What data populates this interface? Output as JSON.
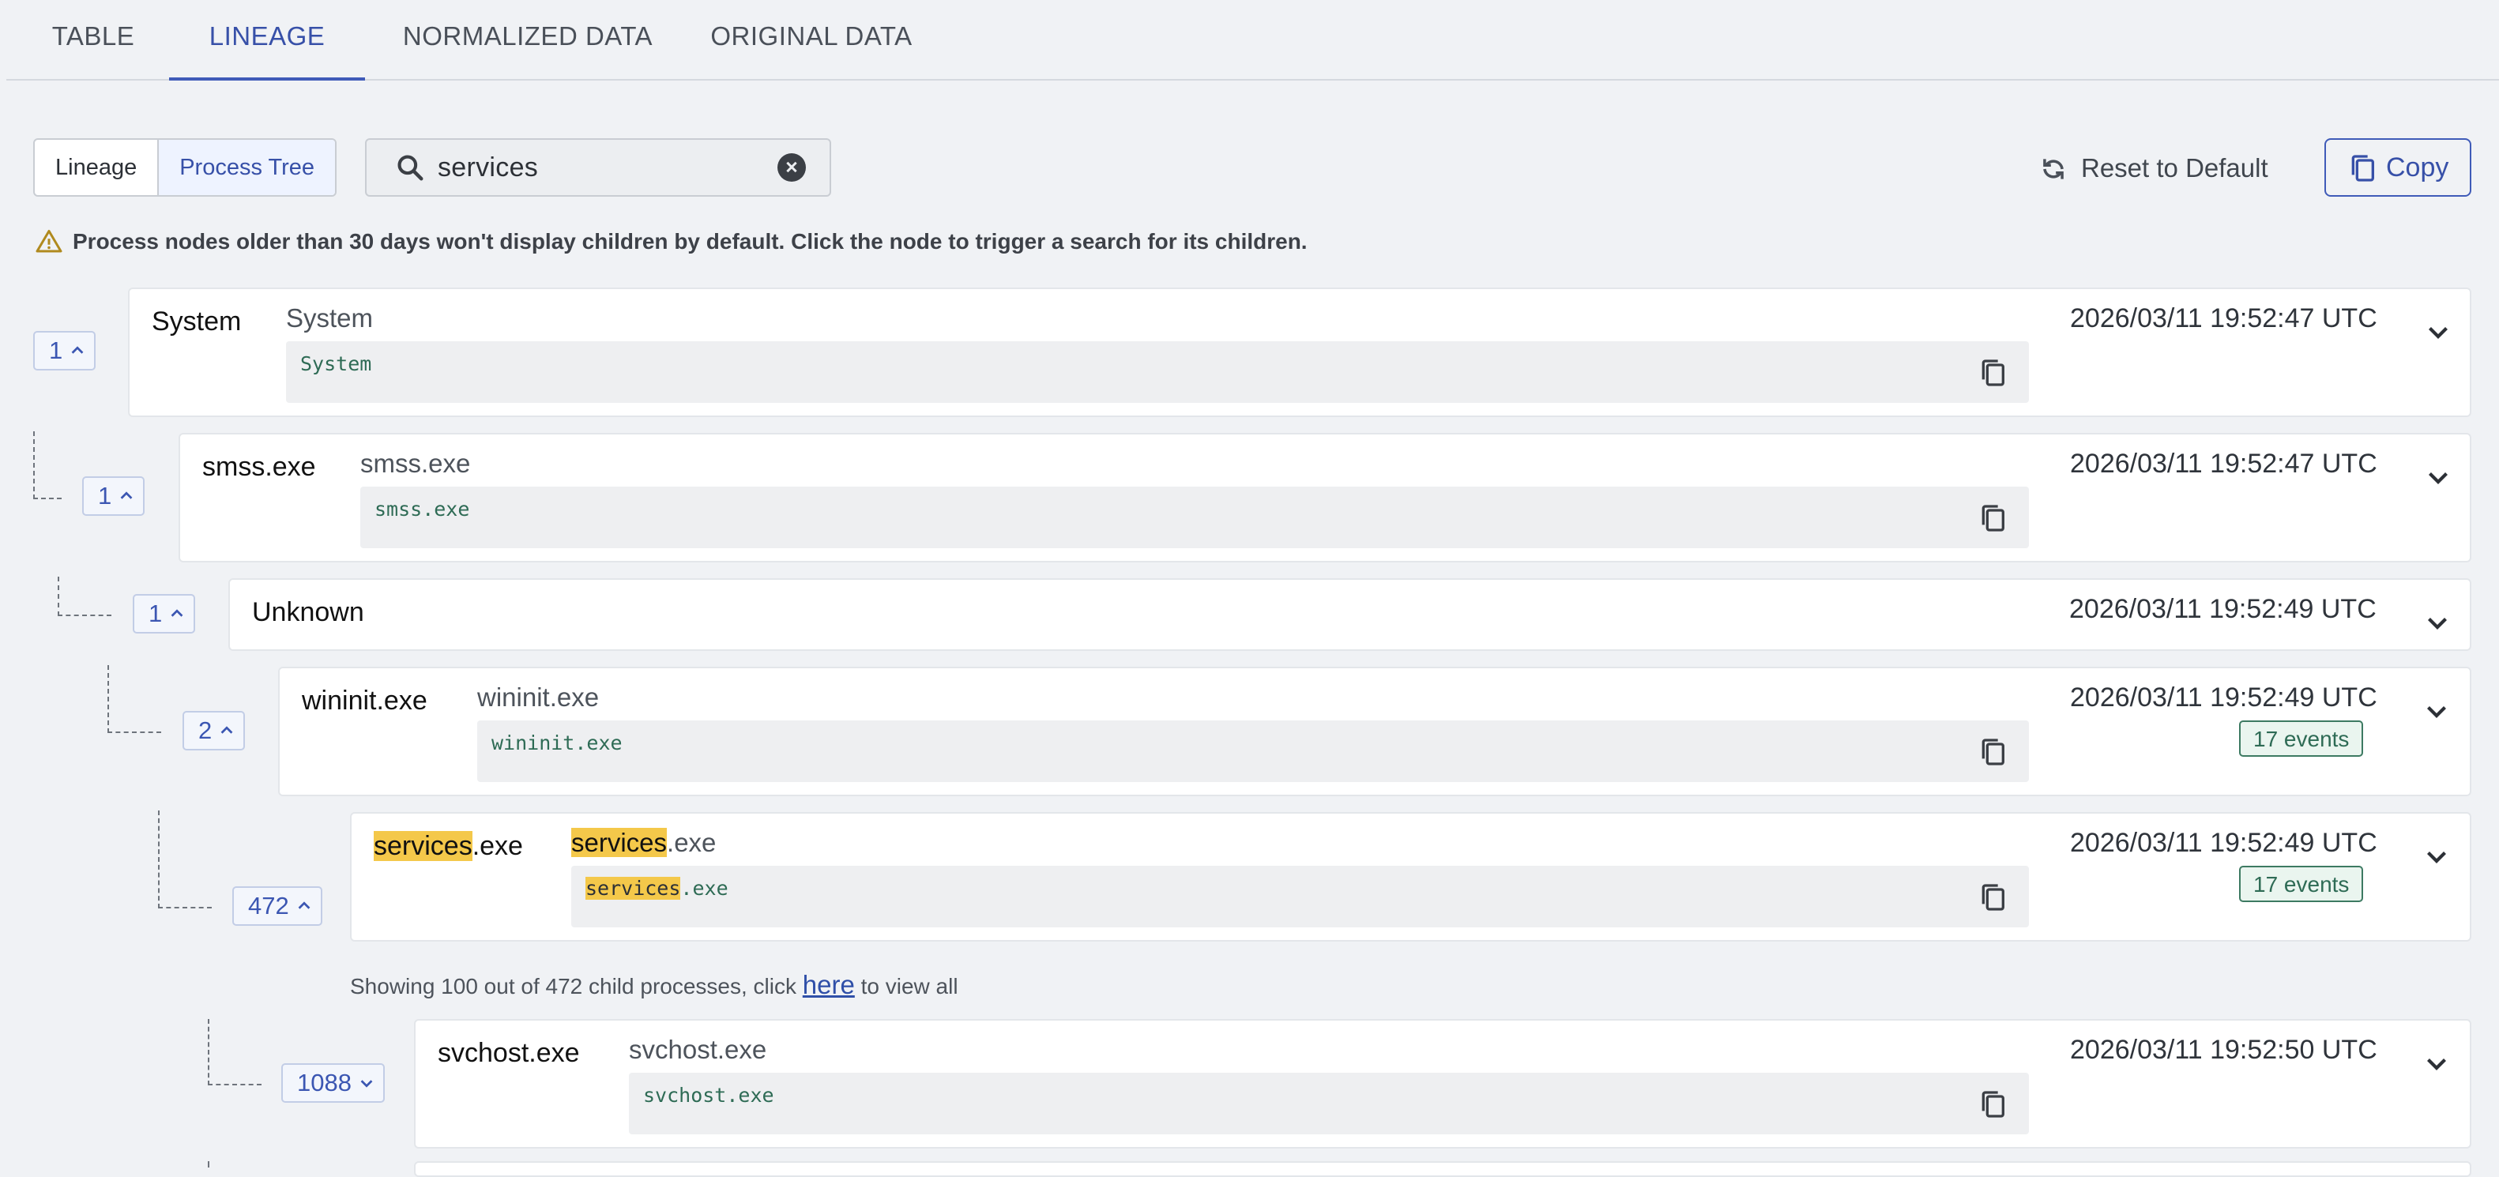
{
  "tabs": [
    "TABLE",
    "LINEAGE",
    "NORMALIZED DATA",
    "ORIGINAL DATA"
  ],
  "toolbar": {
    "mode_lineage": "Lineage",
    "mode_process_tree": "Process Tree",
    "search_value": "services",
    "reset_label": "Reset to Default",
    "copy_label": "Copy"
  },
  "warning": "Process nodes older than 30 days won't display children by default. Click the node to trigger a search for its children.",
  "nodes": [
    {
      "count": "1",
      "name": "System",
      "sub": "System",
      "cmd": "System",
      "time": "2026/03/11 19:52:47 UTC"
    },
    {
      "count": "1",
      "name": "smss.exe",
      "sub": "smss.exe",
      "cmd": "smss.exe",
      "time": "2026/03/11 19:52:47 UTC"
    },
    {
      "count": "1",
      "name": "Unknown",
      "time": "2026/03/11 19:52:49 UTC"
    },
    {
      "count": "2",
      "name": "wininit.exe",
      "sub": "wininit.exe",
      "cmd": "wininit.exe",
      "time": "2026/03/11 19:52:49 UTC",
      "events": "17 events"
    },
    {
      "count": "472",
      "name_hl": "services",
      "name_rest": ".exe",
      "sub_hl": "services",
      "sub_rest": ".exe",
      "cmd_hl": "services",
      "cmd_rest": ".exe",
      "time": "2026/03/11 19:52:49 UTC",
      "events": "17 events"
    },
    {
      "count": "1088",
      "name": "svchost.exe",
      "sub": "svchost.exe",
      "cmd": "svchost.exe",
      "time": "2026/03/11 19:52:50 UTC"
    }
  ],
  "child_note": {
    "prefix": "Showing 100 out of 472 child processes, click",
    "link": "here",
    "suffix": "to view all"
  },
  "colors": {
    "accent": "#3f5bb8",
    "highlight": "#f4c84a",
    "events": "#2e6b55"
  }
}
